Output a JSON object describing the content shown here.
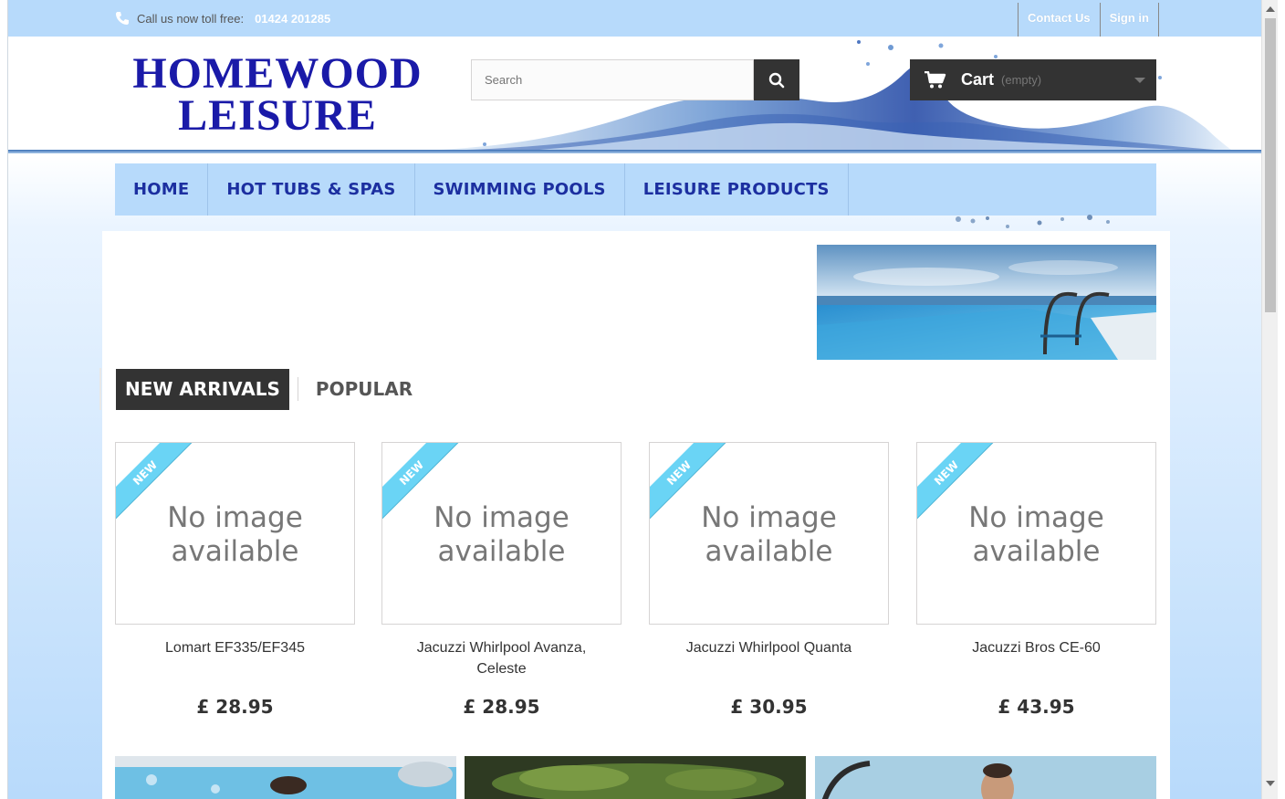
{
  "topbar": {
    "phone_prefix": "Call us now toll free:",
    "phone_number": "01424 201285",
    "contact_label": "Contact Us",
    "signin_label": "Sign in"
  },
  "header": {
    "logo_line1": "HOMEWOOD",
    "logo_line2": "LEISURE",
    "search_placeholder": "Search",
    "cart_label": "Cart",
    "cart_status": "(empty)"
  },
  "nav": {
    "items": [
      {
        "label": "HOME"
      },
      {
        "label": "HOT TUBS & SPAS"
      },
      {
        "label": "SWIMMING POOLS"
      },
      {
        "label": "LEISURE PRODUCTS"
      }
    ]
  },
  "tabs": {
    "active": "NEW ARRIVALS",
    "other": "POPULAR"
  },
  "products": [
    {
      "badge": "NEW",
      "placeholder_line1": "No image",
      "placeholder_line2": "available",
      "name": "Lomart EF335/EF345",
      "price": "£ 28.95"
    },
    {
      "badge": "NEW",
      "placeholder_line1": "No image",
      "placeholder_line2": "available",
      "name": "Jacuzzi Whirlpool Avanza, Celeste",
      "price": "£ 28.95"
    },
    {
      "badge": "NEW",
      "placeholder_line1": "No image",
      "placeholder_line2": "available",
      "name": "Jacuzzi Whirlpool Quanta",
      "price": "£ 30.95"
    },
    {
      "badge": "NEW",
      "placeholder_line1": "No image",
      "placeholder_line2": "available",
      "name": "Jacuzzi Bros CE-60",
      "price": "£ 43.95"
    }
  ],
  "colors": {
    "topbar_bg": "#b7dafb",
    "nav_text": "#1c2fa0",
    "logo": "#1a1aa8",
    "ribbon": "#6ad4f5",
    "dark": "#333333"
  }
}
